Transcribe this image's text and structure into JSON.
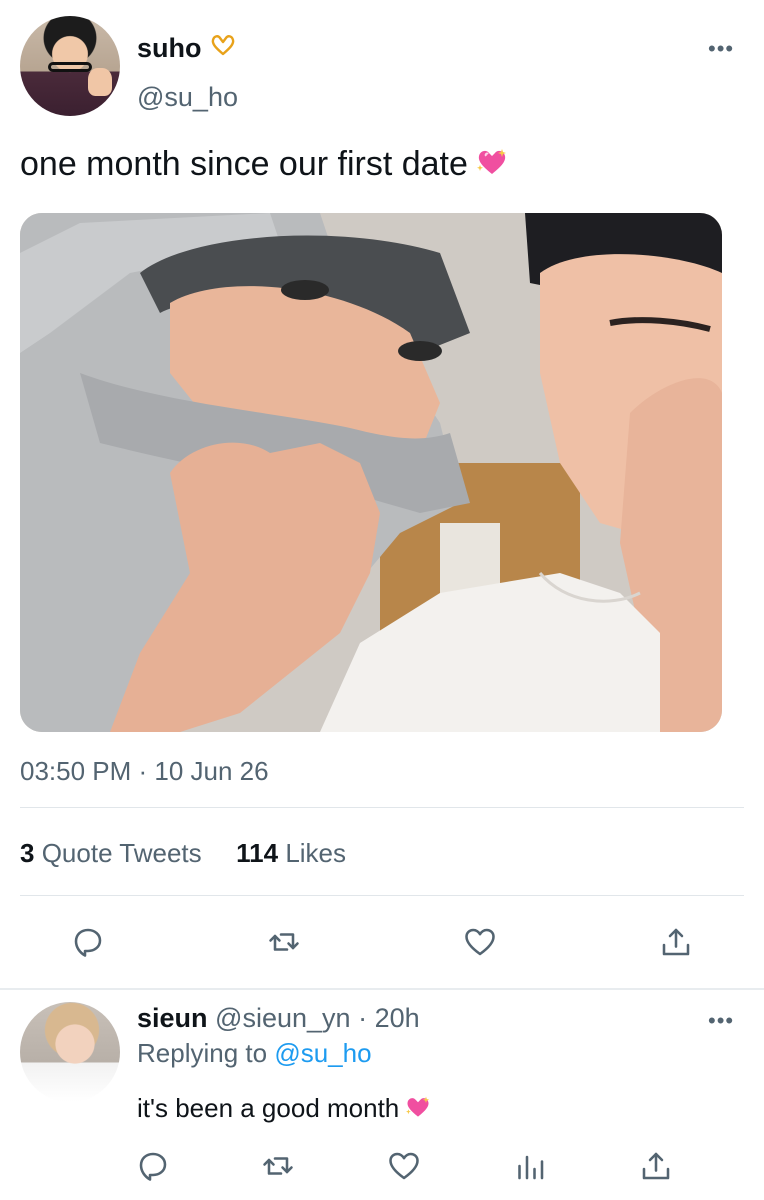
{
  "tweet": {
    "display_name": "suho",
    "name_emoji": "🫶",
    "handle": "@su_ho",
    "text": "one month since our first date",
    "text_emoji": "sparkling-heart",
    "timestamp": "03:50 PM · 10 Jun 26",
    "quote_count": "3",
    "quote_label": "Quote Tweets",
    "like_count": "114",
    "like_label": "Likes",
    "more_label": "•••"
  },
  "reply": {
    "display_name": "sieun",
    "handle": "@sieun_yn",
    "separator": "·",
    "age": "20h",
    "replying_prefix": "Replying to",
    "replying_to": "@su_ho",
    "text": "it's been a good month",
    "text_emoji": "sparkling-heart",
    "more_label": "•••"
  },
  "icons": {
    "reply": "reply-icon",
    "retweet": "retweet-icon",
    "like": "heart-icon",
    "share": "share-icon",
    "analytics": "analytics-icon"
  },
  "colors": {
    "text": "#0f1419",
    "secondary": "#536471",
    "link": "#1d9bf0",
    "divider": "#e1e6ea",
    "emoji_heart": "#f04fa0"
  }
}
